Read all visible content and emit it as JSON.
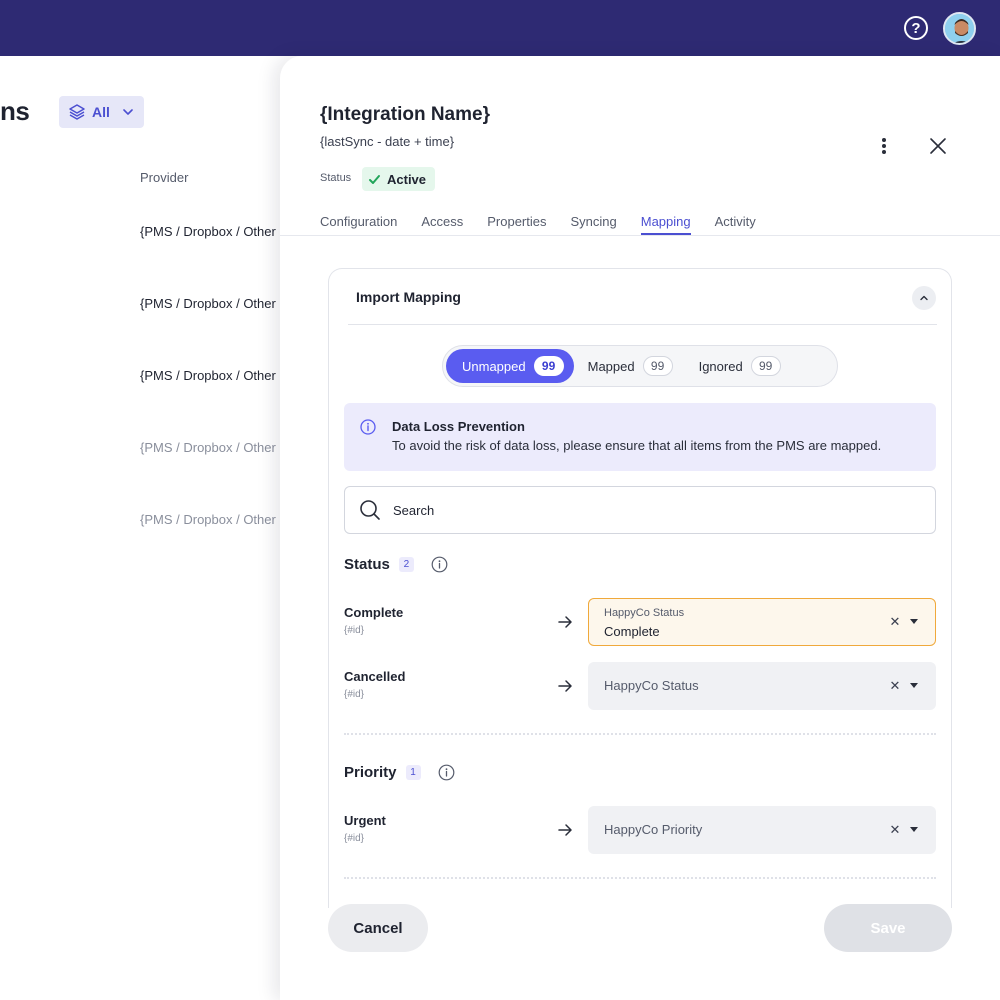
{
  "topbar": {
    "help_icon": "help-circle-icon",
    "avatar": "user-avatar"
  },
  "background": {
    "title_fragment": "ns",
    "filter_chip": {
      "icon": "layers-icon",
      "label": "All"
    },
    "column_header": "Provider",
    "rows": [
      "{PMS / Dropbox / Other",
      "{PMS / Dropbox / Other",
      "{PMS / Dropbox / Other",
      "{PMS / Dropbox / Other",
      "{PMS / Dropbox / Other"
    ]
  },
  "drawer": {
    "title": "{Integration Name}",
    "subtitle": "{lastSync - date + time}",
    "status_label": "Status",
    "status_value": "Active",
    "tabs": [
      {
        "label": "Configuration",
        "active": false
      },
      {
        "label": "Access",
        "active": false
      },
      {
        "label": "Properties",
        "active": false
      },
      {
        "label": "Syncing",
        "active": false
      },
      {
        "label": "Mapping",
        "active": true
      },
      {
        "label": "Activity",
        "active": false
      }
    ]
  },
  "import_mapping": {
    "title": "Import Mapping",
    "segments": [
      {
        "label": "Unmapped",
        "count": "99",
        "active": true
      },
      {
        "label": "Mapped",
        "count": "99",
        "active": false
      },
      {
        "label": "Ignored",
        "count": "99",
        "active": false
      }
    ],
    "alert": {
      "title": "Data Loss Prevention",
      "body": "To avoid the risk of data loss, please ensure that all items from the PMS are mapped."
    },
    "search": {
      "placeholder": "Search"
    },
    "groups": [
      {
        "name": "Status",
        "count": "2",
        "rows": [
          {
            "name": "Complete",
            "id": "{#id}",
            "select_label": "HappyCo Status",
            "select_value": "Complete",
            "focused": true
          },
          {
            "name": "Cancelled",
            "id": "{#id}",
            "select_placeholder": "HappyCo Status",
            "focused": false
          }
        ]
      },
      {
        "name": "Priority",
        "count": "1",
        "rows": [
          {
            "name": "Urgent",
            "id": "{#id}",
            "select_placeholder": "HappyCo Priority",
            "focused": false
          }
        ]
      }
    ]
  },
  "footer": {
    "cancel": "Cancel",
    "save": "Save"
  },
  "colors": {
    "topbar": "#2e2a73",
    "accent": "#5a5cf0",
    "success_bg": "#e5f7ec",
    "success": "#22a55a",
    "focus_border": "#f0a93b",
    "alert_bg": "#ecebfc"
  }
}
